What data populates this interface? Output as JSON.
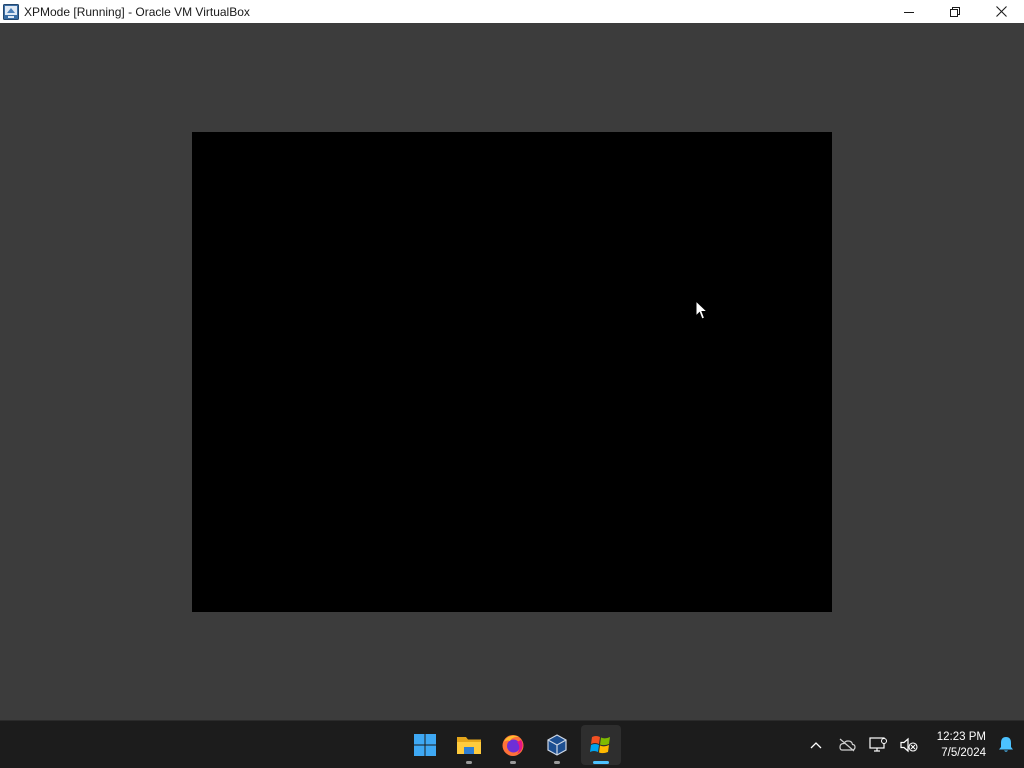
{
  "window": {
    "title": "XPMode [Running] - Oracle VM VirtualBox",
    "icon": "virtualbox-icon",
    "controls": [
      "minimize-icon",
      "restore-icon",
      "close-icon"
    ]
  },
  "vm": {
    "display_color": "#000000",
    "background_color": "#3c3c3c"
  },
  "taskbar": {
    "apps": [
      {
        "name": "start-button",
        "icon": "windows-logo-icon",
        "running": false,
        "active": false
      },
      {
        "name": "file-explorer",
        "icon": "folder-icon",
        "running": true,
        "active": false
      },
      {
        "name": "firefox",
        "icon": "firefox-icon",
        "running": true,
        "active": false
      },
      {
        "name": "virtualbox",
        "icon": "virtualbox-cube-icon",
        "running": true,
        "active": false
      },
      {
        "name": "xpmode",
        "icon": "windows-xp-flag-icon",
        "running": true,
        "active": true
      }
    ],
    "tray": {
      "icons": [
        "chevron-up-icon",
        "onedrive-offline-icon",
        "network-icon",
        "volume-muted-icon",
        "bell-icon"
      ]
    },
    "clock": {
      "time": "12:23 PM",
      "date": "7/5/2024"
    }
  },
  "colors": {
    "accent": "#4cc2ff",
    "taskbar": "#1c1c1c",
    "titlebar": "#ffffff"
  }
}
